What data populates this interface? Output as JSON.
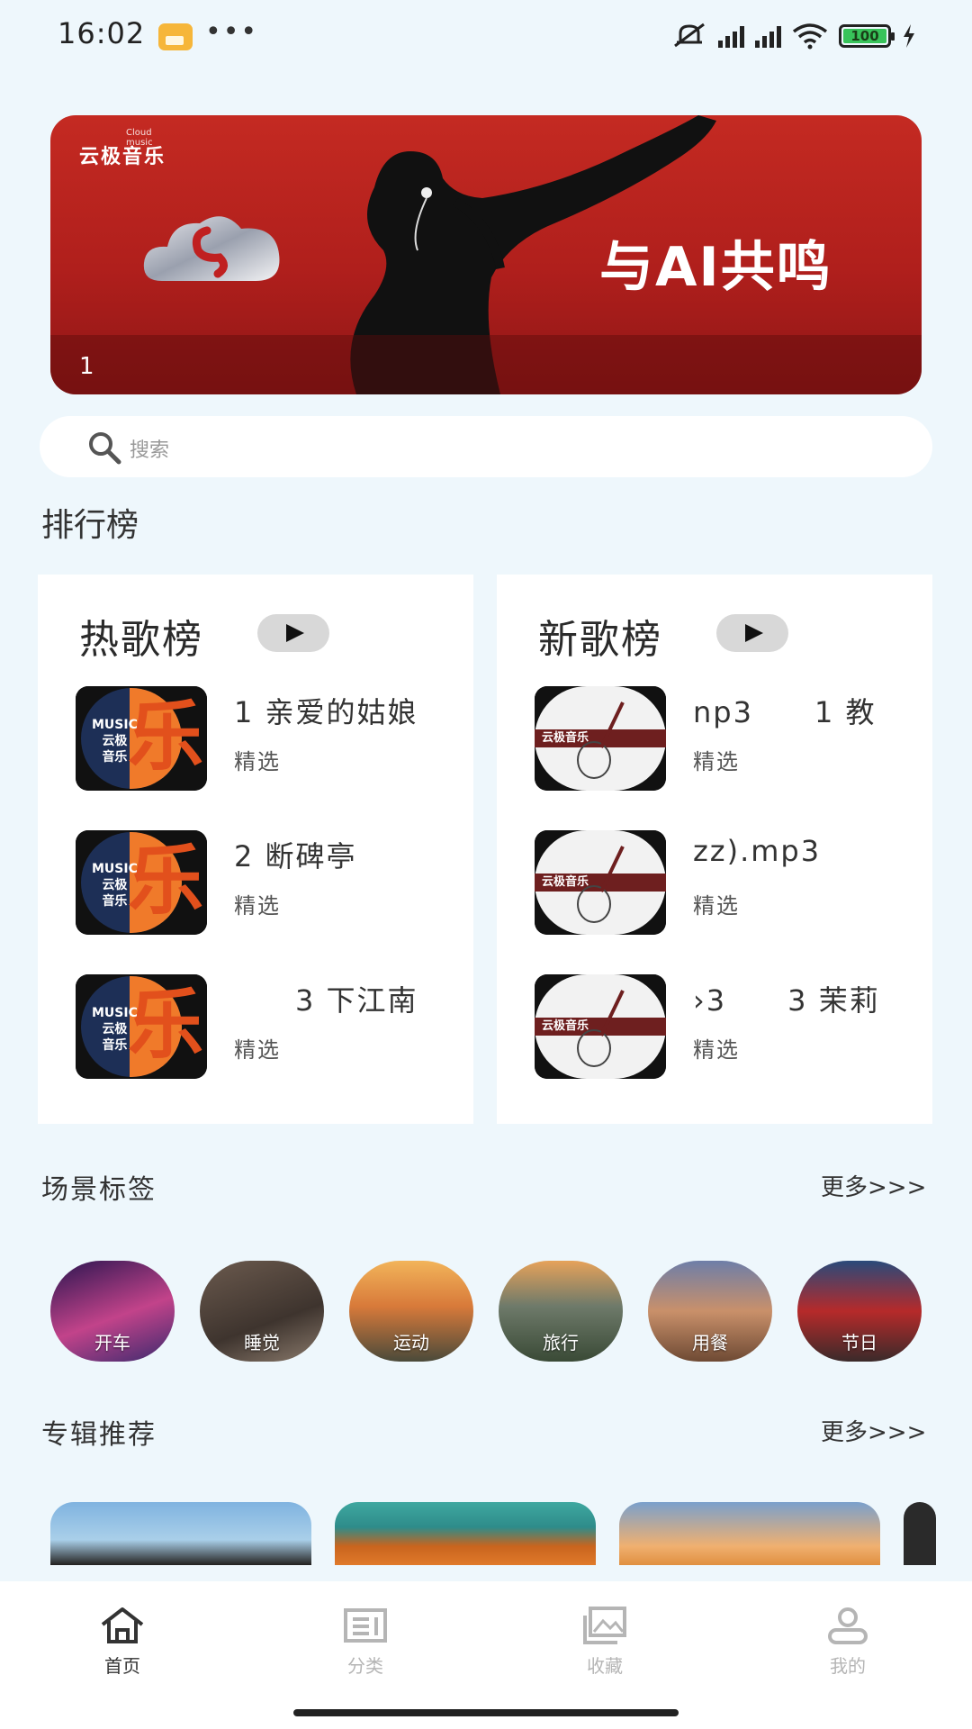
{
  "status_bar": {
    "time": "16:02",
    "more": "•••",
    "battery": "100",
    "icons": [
      "app-notification-icon",
      "mute-icon",
      "signal-hd-icon",
      "signal-hd-icon",
      "wifi-icon",
      "battery-icon",
      "charging-icon"
    ]
  },
  "banner": {
    "brand": "云极音乐",
    "brand_sub": "Cloud music",
    "slogan": "与AI共鸣",
    "index": "1",
    "background": "#b01f1c"
  },
  "search": {
    "placeholder": "搜索"
  },
  "ranking": {
    "title": "排行榜",
    "lists": [
      {
        "name": "热歌榜",
        "songs": [
          {
            "title": "1 亲爱的姑娘",
            "tag": "精选"
          },
          {
            "title": "2 断碑亭",
            "tag": "精选"
          },
          {
            "title": "　　3 下江南",
            "tag": "精选"
          }
        ]
      },
      {
        "name": "新歌榜",
        "songs": [
          {
            "title": "np3　　1 教",
            "tag": "精选"
          },
          {
            "title": "zz).mp3",
            "tag": "精选"
          },
          {
            "title": "›3　　3 茉莉",
            "tag": "精选"
          }
        ]
      }
    ]
  },
  "scenes": {
    "title": "场景标签",
    "more": "更多>>>",
    "items": [
      {
        "label": "开车"
      },
      {
        "label": "睡觉"
      },
      {
        "label": "运动"
      },
      {
        "label": "旅行"
      },
      {
        "label": "用餐"
      },
      {
        "label": "节日"
      }
    ]
  },
  "albums": {
    "title": "专辑推荐",
    "more": "更多>>>"
  },
  "bottom_nav": {
    "items": [
      {
        "label": "首页",
        "icon": "home-icon",
        "active": true
      },
      {
        "label": "分类",
        "icon": "list-icon",
        "active": false
      },
      {
        "label": "收藏",
        "icon": "gallery-icon",
        "active": false
      },
      {
        "label": "我的",
        "icon": "user-icon",
        "active": false
      }
    ],
    "active_color": "#333333",
    "inactive_color": "#b5b5b5"
  }
}
